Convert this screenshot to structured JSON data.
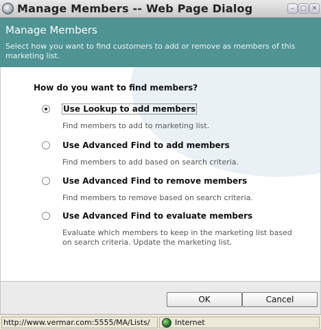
{
  "window": {
    "title": "Manage Members -- Web Page Dialog",
    "buttons": [
      "–",
      "□",
      "✕"
    ]
  },
  "header": {
    "title": "Manage Members",
    "description": "Select how you want to find customers to add or remove as members of this marketing list."
  },
  "question": "How do you want to find members?",
  "options": [
    {
      "label": "Use Lookup to add members",
      "description": "Find members to add to marketing list.",
      "selected": true
    },
    {
      "label": "Use Advanced Find to add members",
      "description": "Find members to add based on search criteria.",
      "selected": false
    },
    {
      "label": "Use Advanced Find to remove members",
      "description": "Find members to remove based on search criteria.",
      "selected": false
    },
    {
      "label": "Use Advanced Find to evaluate members",
      "description": "Evaluate which members to keep in the marketing list based on search criteria. Update the marketing list.",
      "selected": false
    }
  ],
  "footer": {
    "ok_label": "OK",
    "cancel_label": "Cancel"
  },
  "statusbar": {
    "url": "http://www.vermar.com:5555/MA/Lists/",
    "zone": "Internet",
    "zone_icon": "globe-icon"
  },
  "colors": {
    "header_bg": "#4f9393"
  }
}
